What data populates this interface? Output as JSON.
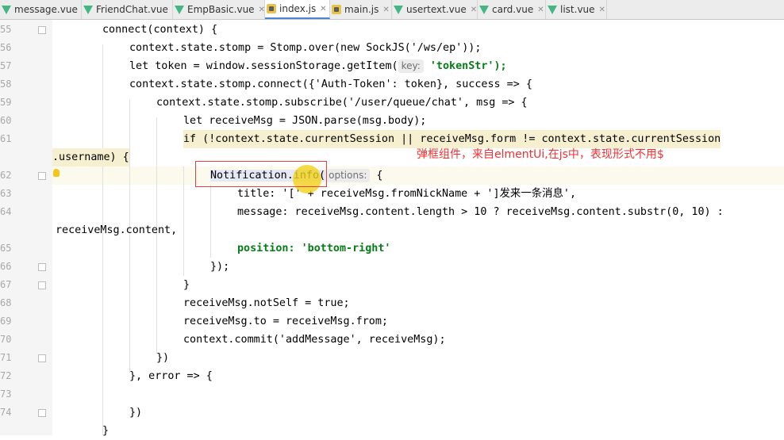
{
  "tabs": [
    {
      "label": "message.vue",
      "type": "vue"
    },
    {
      "label": "FriendChat.vue",
      "type": "vue"
    },
    {
      "label": "EmpBasic.vue",
      "type": "vue"
    },
    {
      "label": "index.js",
      "type": "js",
      "active": true
    },
    {
      "label": "main.js",
      "type": "js"
    },
    {
      "label": "usertext.vue",
      "type": "vue"
    },
    {
      "label": "card.vue",
      "type": "vue"
    },
    {
      "label": "list.vue",
      "type": "vue"
    }
  ],
  "line_numbers": [
    "55",
    "56",
    "57",
    "58",
    "59",
    "60",
    "61",
    "",
    "62",
    "63",
    "64",
    "",
    "65",
    "66",
    "67",
    "68",
    "69",
    "70",
    "71",
    "72",
    "73",
    "74",
    ""
  ],
  "code": {
    "l55": "connect(context) {",
    "l56_a": "context.state.stomp = Stomp.over(new SockJS('/ws/ep'));",
    "l57_a": "let token = window.sessionStorage.getItem(",
    "l57_hint": "key:",
    "l57_b": " 'tokenStr');",
    "l58": "context.state.stomp.connect({'Auth-Token': token}, success => {",
    "l59": "context.state.stomp.subscribe('/user/queue/chat', msg => {",
    "l60": "let receiveMsg = JSON.parse(msg.body);",
    "l61": "if (!context.state.currentSession || receiveMsg.form != context.state.currentSession",
    "l61_wrap": ".username) {",
    "l62_a": "Notification.info(",
    "l62_hint": "options:",
    "l62_b": " {",
    "l63": "title: '[' + receiveMsg.fromNickName + ']发来一条消息',",
    "l64": "message: receiveMsg.content.length > 10 ? receiveMsg.content.substr(0, 10) :",
    "l64_wrap": "receiveMsg.content,",
    "l65": "position: 'bottom-right'",
    "l66": "});",
    "l67": "}",
    "l68": "receiveMsg.notSelf = true;",
    "l69": "receiveMsg.to = receiveMsg.from;",
    "l70": "context.commit('addMessage', receiveMsg);",
    "l71": "})",
    "l72": "}, error => {",
    "l73": "",
    "l74": "})",
    "l75": "}"
  },
  "annotation": "弹框组件，来自elmentUi,在js中，表现形式不用$",
  "colors": {
    "keyword": "#000080",
    "string": "#067d17",
    "number": "#1750eb",
    "field": "#660e7a",
    "annotation": "#f03030",
    "box": "#e04040"
  }
}
